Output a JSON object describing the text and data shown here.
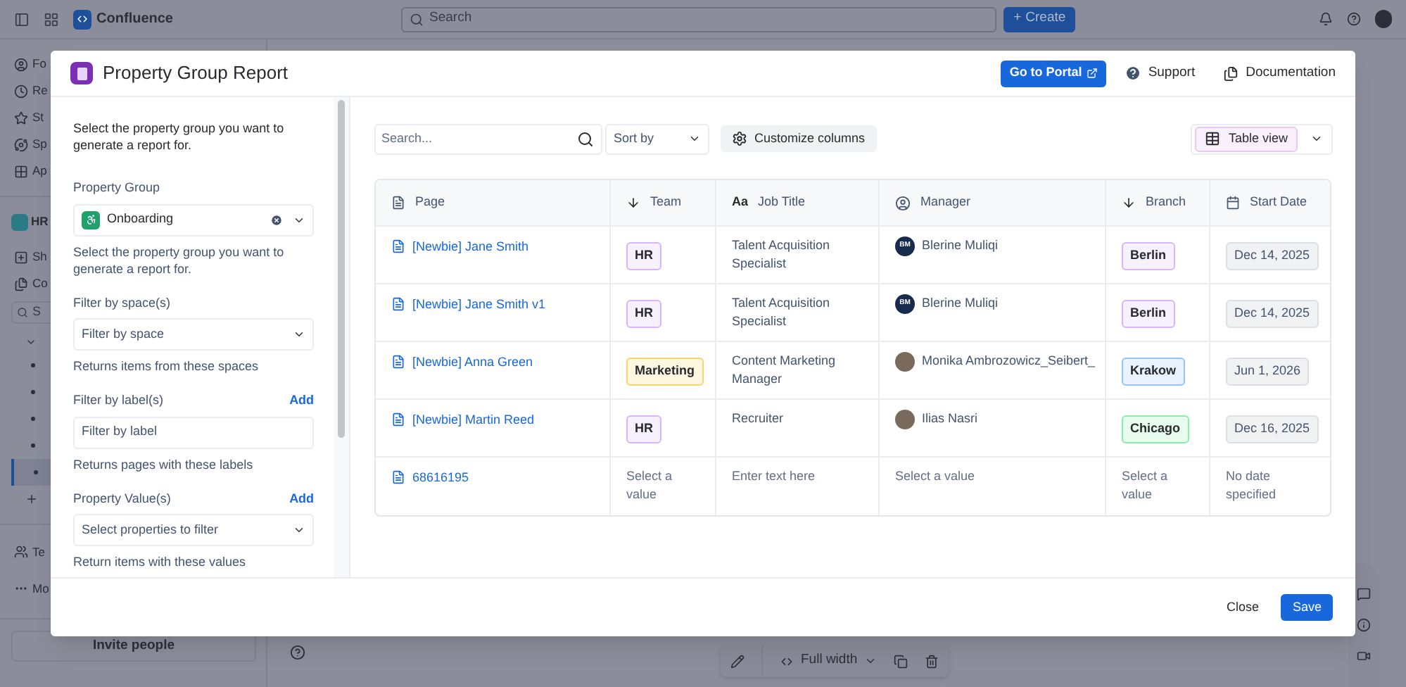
{
  "topbar": {
    "product": "Confluence",
    "search_placeholder": "Search",
    "create": "Create",
    "create_icon": "+"
  },
  "sidebar": {
    "items": [
      {
        "label": "Fo"
      },
      {
        "label": "Re"
      },
      {
        "label": "St"
      },
      {
        "label": "Sp"
      },
      {
        "label": "Ap"
      }
    ],
    "space": {
      "label": "HR"
    },
    "space_items": [
      {
        "label": "Sh"
      },
      {
        "label": "Co"
      }
    ],
    "search": {
      "placeholder": "S"
    },
    "tree": [
      {
        "selected": false
      },
      {
        "selected": false
      },
      {
        "selected": false
      },
      {
        "selected": false
      },
      {
        "selected": true
      }
    ],
    "bottom_items": [
      {
        "label": "Te"
      },
      {
        "label": "Mo"
      }
    ],
    "invite": "Invite people"
  },
  "floating_toolbar": {
    "width_label": "Full width"
  },
  "modal": {
    "title": "Property Group Report",
    "portal_button": "Go to Portal",
    "support": "Support",
    "documentation": "Documentation",
    "left_panel": {
      "intro": "Select the property group you want to generate a report for.",
      "fields": [
        {
          "kind": "select",
          "label": "Property Group",
          "value": "Onboarding",
          "clearable": true,
          "help": "Select the property group you want to generate a report for."
        },
        {
          "kind": "select",
          "label": "Filter by space(s)",
          "placeholder": "Filter by space",
          "help": "Returns items from these spaces"
        },
        {
          "kind": "input",
          "label": "Filter by label(s)",
          "action": "Add",
          "placeholder": "Filter by label",
          "help": "Returns pages with these labels"
        },
        {
          "kind": "select",
          "label": "Property Value(s)",
          "action": "Add",
          "placeholder": "Select properties to filter",
          "help": "Return items with these values"
        }
      ]
    },
    "toolbar": {
      "search_placeholder": "Search...",
      "sort_placeholder": "Sort by",
      "customize": "Customize columns",
      "view": "Table view"
    },
    "table": {
      "columns": [
        {
          "label": "Page"
        },
        {
          "label": "Team"
        },
        {
          "label": "Job Title",
          "icon_text": "Aa"
        },
        {
          "label": "Manager"
        },
        {
          "label": "Branch"
        },
        {
          "label": "Start Date"
        }
      ],
      "rows": [
        {
          "page": "[Newbie] Jane Smith",
          "team": {
            "kind": "tag",
            "text": "HR",
            "color": "#d8b4fe"
          },
          "job_title": {
            "kind": "text",
            "text": "Talent Acquisition Specialist"
          },
          "manager": {
            "kind": "initials",
            "initials": "BM",
            "name": "Blerine Muliqi"
          },
          "branch": {
            "kind": "tag",
            "text": "Berlin",
            "color": "#d8b4fe"
          },
          "start_date": {
            "kind": "date",
            "text": "Dec 14, 2025"
          }
        },
        {
          "page": "[Newbie] Jane Smith v1",
          "team": {
            "kind": "tag",
            "text": "HR",
            "color": "#d8b4fe"
          },
          "job_title": {
            "kind": "text",
            "text": "Talent Acquisition Specialist"
          },
          "manager": {
            "kind": "initials",
            "initials": "BM",
            "name": "Blerine Muliqi"
          },
          "branch": {
            "kind": "tag",
            "text": "Berlin",
            "color": "#d8b4fe"
          },
          "start_date": {
            "kind": "date",
            "text": "Dec 14, 2025"
          }
        },
        {
          "page": "[Newbie] Anna Green",
          "team": {
            "kind": "tag",
            "text": "Marketing",
            "color": "#f5d565"
          },
          "job_title": {
            "kind": "text",
            "text": "Content Marketing Manager"
          },
          "manager": {
            "kind": "photo",
            "name": "Monika Ambrozowicz_Seibert_"
          },
          "branch": {
            "kind": "tag",
            "text": "Krakow",
            "color": "#93c5fd"
          },
          "start_date": {
            "kind": "date",
            "text": "Jun 1, 2026"
          }
        },
        {
          "page": "[Newbie] Martin Reed",
          "team": {
            "kind": "tag",
            "text": "HR",
            "color": "#d8b4fe"
          },
          "job_title": {
            "kind": "text",
            "text": "Recruiter"
          },
          "manager": {
            "kind": "photo",
            "name": "Ilias Nasri"
          },
          "branch": {
            "kind": "tag",
            "text": "Chicago",
            "color": "#86efac"
          },
          "start_date": {
            "kind": "date",
            "text": "Dec 16, 2025"
          }
        },
        {
          "page": "68616195",
          "team": {
            "kind": "placeholder",
            "text": "Select a value"
          },
          "job_title": {
            "kind": "placeholder",
            "text": "Enter text here"
          },
          "manager": {
            "kind": "placeholder",
            "name": "Select a value"
          },
          "branch": {
            "kind": "placeholder",
            "text": "Select a value"
          },
          "start_date": {
            "kind": "placeholder",
            "text": "No date specified"
          }
        }
      ]
    },
    "footer": {
      "close": "Close",
      "save": "Save"
    }
  }
}
